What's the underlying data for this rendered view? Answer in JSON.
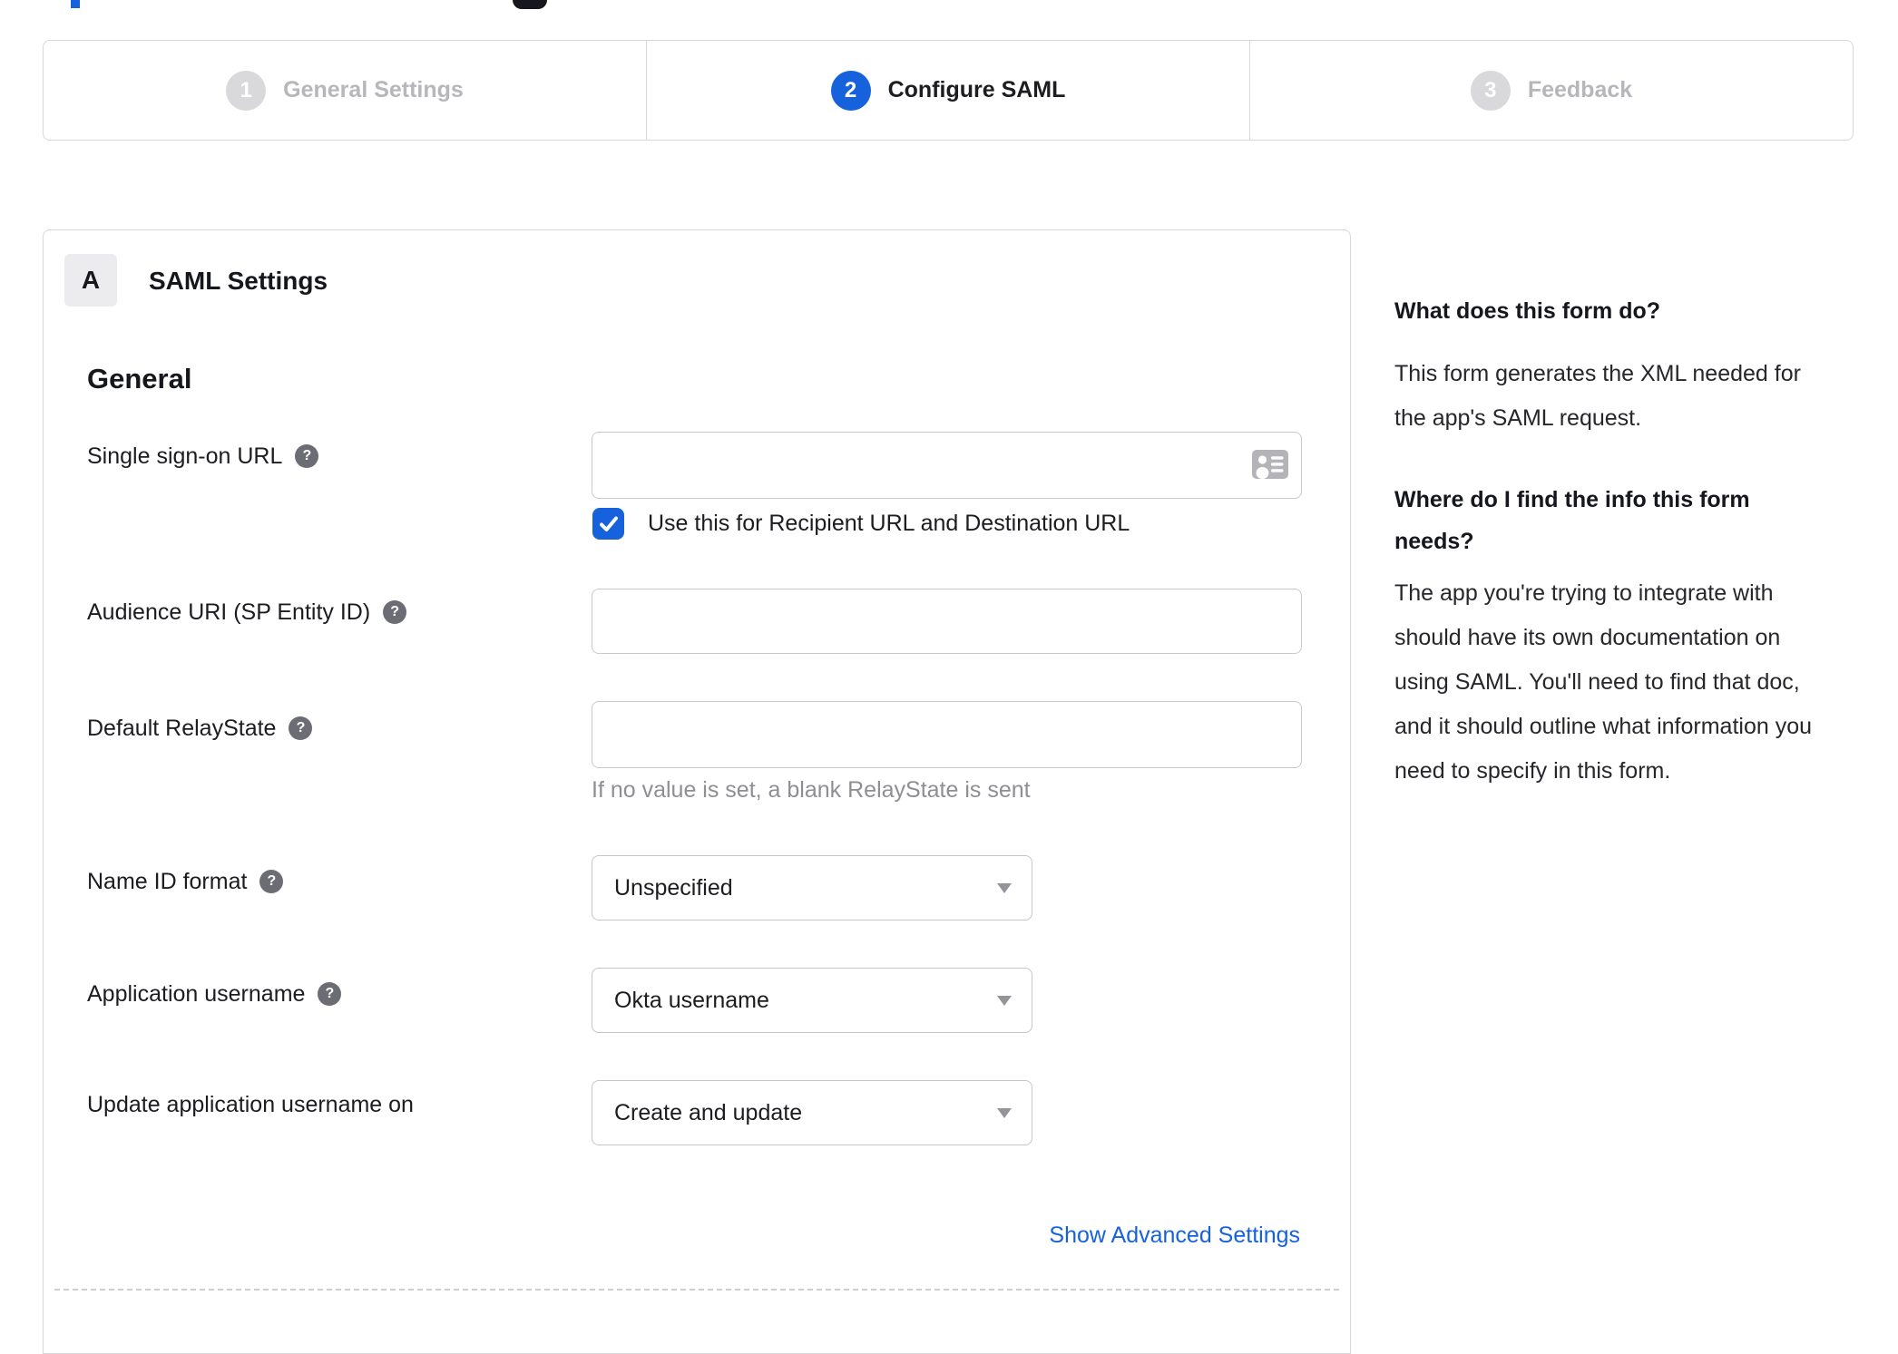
{
  "stepper": {
    "steps": [
      {
        "number": "1",
        "label": "General Settings",
        "active": false
      },
      {
        "number": "2",
        "label": "Configure SAML",
        "active": true
      },
      {
        "number": "3",
        "label": "Feedback",
        "active": false
      }
    ]
  },
  "saml_panel": {
    "badge": "A",
    "title": "SAML Settings",
    "group_heading": "General",
    "sso_url": {
      "label": "Single sign-on URL",
      "value": "",
      "checkbox_label": "Use this for Recipient URL and Destination URL",
      "checkbox_checked": true
    },
    "audience_uri": {
      "label": "Audience URI (SP Entity ID)",
      "value": ""
    },
    "default_relaystate": {
      "label": "Default RelayState",
      "value": "",
      "hint": "If no value is set, a blank RelayState is sent"
    },
    "name_id_format": {
      "label": "Name ID format",
      "value": "Unspecified"
    },
    "application_username": {
      "label": "Application username",
      "value": "Okta username"
    },
    "update_application_username": {
      "label": "Update application username on",
      "value": "Create and update"
    },
    "advanced_link": "Show Advanced Settings"
  },
  "help_sidebar": {
    "q1_title": "What does this form do?",
    "q1_body": "This form generates the XML needed for the app's SAML request.",
    "q2_title": "Where do I find the info this form needs?",
    "q2_body": "The app you're trying to integrate with should have its own documentation on using SAML. You'll need to find that doc, and it should outline what information you need to specify in this form."
  },
  "icons": {
    "help_glyph": "?"
  },
  "colors": {
    "accent_blue": "#1662dd",
    "inactive_circle": "#d9d9dc",
    "inactive_label": "#b6b6bb",
    "border_gray": "#d8d8da",
    "text_dark": "#1d1d21",
    "hint_gray": "#8e8e93"
  }
}
